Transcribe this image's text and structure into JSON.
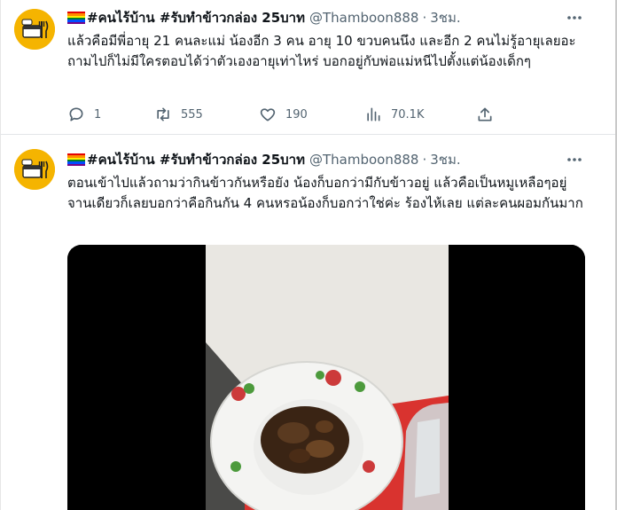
{
  "tweets": [
    {
      "display_name": "#คนไร้บ้าน #รับทำข้าวกล่อง 25บาท",
      "handle": "@Thamboon888",
      "separator": "·",
      "time": "3ชม.",
      "more_icon": "more-horizontal-icon",
      "text": "แล้วคือมีพี่อายุ 21 คนละแม่ น้องอีก 3 คน อายุ 10 ขวบคนนึง และอีก 2 คนไม่รู้อายุเลยอะ ถามไปก็ไม่มีใครตอบได้ว่าตัวเองอายุเท่าไหร่ บอกอยู่กับพ่อแม่หนีไปตั้งแต่น้องเด็กๆ",
      "actions": {
        "reply": {
          "icon": "reply-icon",
          "count": "1"
        },
        "retweet": {
          "icon": "retweet-icon",
          "count": "555"
        },
        "like": {
          "icon": "heart-icon",
          "count": "190"
        },
        "views": {
          "icon": "views-chart-icon",
          "count": "70.1K"
        },
        "share": {
          "icon": "share-icon"
        }
      }
    },
    {
      "display_name": "#คนไร้บ้าน #รับทำข้าวกล่อง 25บาท",
      "handle": "@Thamboon888",
      "separator": "·",
      "time": "3ชม.",
      "more_icon": "more-horizontal-icon",
      "text": "ตอนเข้าไปแล้วถามว่ากินข้าวกันหรือยัง น้องก็บอกว่ามีกับข้าวอยู่ แล้วคือเป็นหมูเหลือๆอยู่จานเดียวก็เลยบอกว่าคือกินกัน 4 คนหรอน้องก็บอกว่าใช่ค่ะ ร้องไห้เลย แต่ละคนผอมกันมาก",
      "media": {
        "icon": "food-plate-photo"
      }
    }
  ],
  "colors": {
    "text_primary": "#0f1419",
    "text_secondary": "#536471",
    "avatar_bg": "#f5b400"
  }
}
